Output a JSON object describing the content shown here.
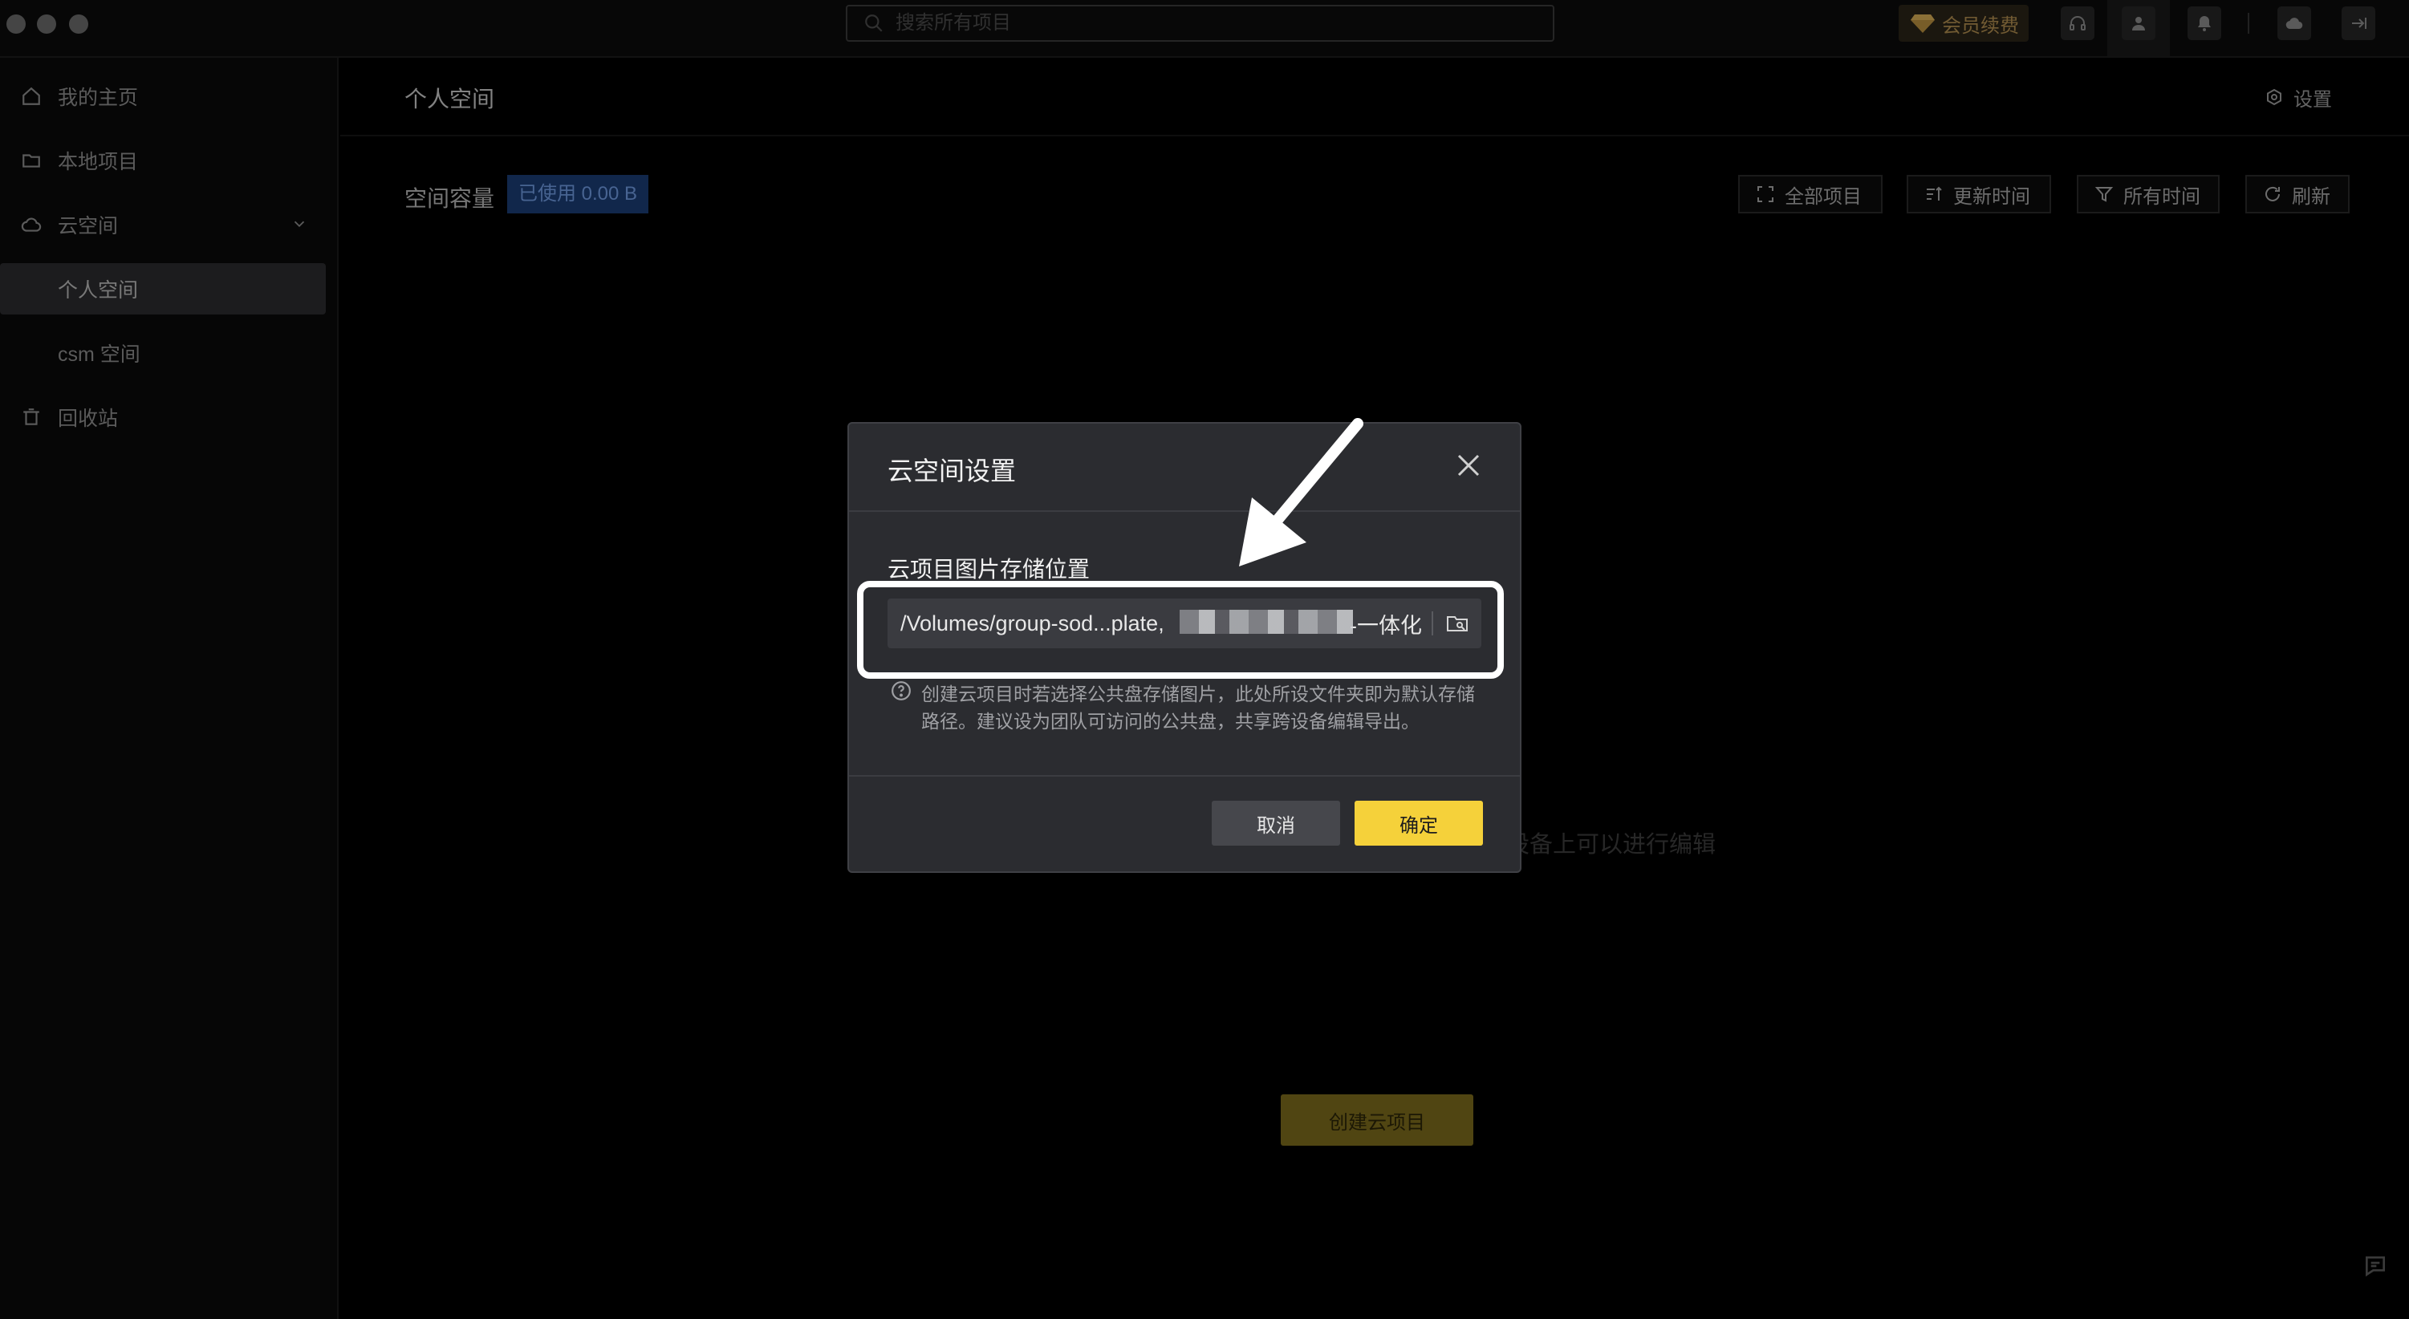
{
  "titlebar": {
    "search_placeholder": "搜索所有项目",
    "vip_label": "会员续费"
  },
  "sidebar": {
    "items": [
      {
        "label": "我的主页",
        "icon": "home-icon"
      },
      {
        "label": "本地项目",
        "icon": "folder-icon"
      },
      {
        "label": "云空间",
        "icon": "cloud-icon"
      },
      {
        "label": "个人空间"
      },
      {
        "label": "csm 空间"
      },
      {
        "label": "回收站",
        "icon": "trash-icon"
      }
    ]
  },
  "main": {
    "title": "个人空间",
    "settings_label": "设置",
    "capacity_label": "空间容量",
    "capacity_badge": "已使用 0.00 B",
    "filters": [
      {
        "label": "全部项目",
        "icon": "grid-icon"
      },
      {
        "label": "更新时间",
        "icon": "sort-icon"
      },
      {
        "label": "所有时间",
        "icon": "filter-icon"
      },
      {
        "label": "刷新",
        "icon": "refresh-icon"
      }
    ],
    "empty_text": "个人云空间，存储在云端，在其他设备上可以进行编辑",
    "create_label": "创建云项目"
  },
  "dialog": {
    "title": "云空间设置",
    "field_label": "云项目图片存储位置",
    "path_value": "/Volumes/group-sod...plate,",
    "path_suffix": "-一体化",
    "hint": "创建云项目时若选择公共盘存储图片，此处所设文件夹即为默认存储路径。建议设为团队可访问的公共盘，共享跨设备编辑导出。",
    "cancel_label": "取消",
    "ok_label": "确定"
  },
  "colors": {
    "accent": "#f5d13a",
    "capacity_badge_bg": "#1b3c74",
    "dialog_bg": "#2b2c30"
  }
}
